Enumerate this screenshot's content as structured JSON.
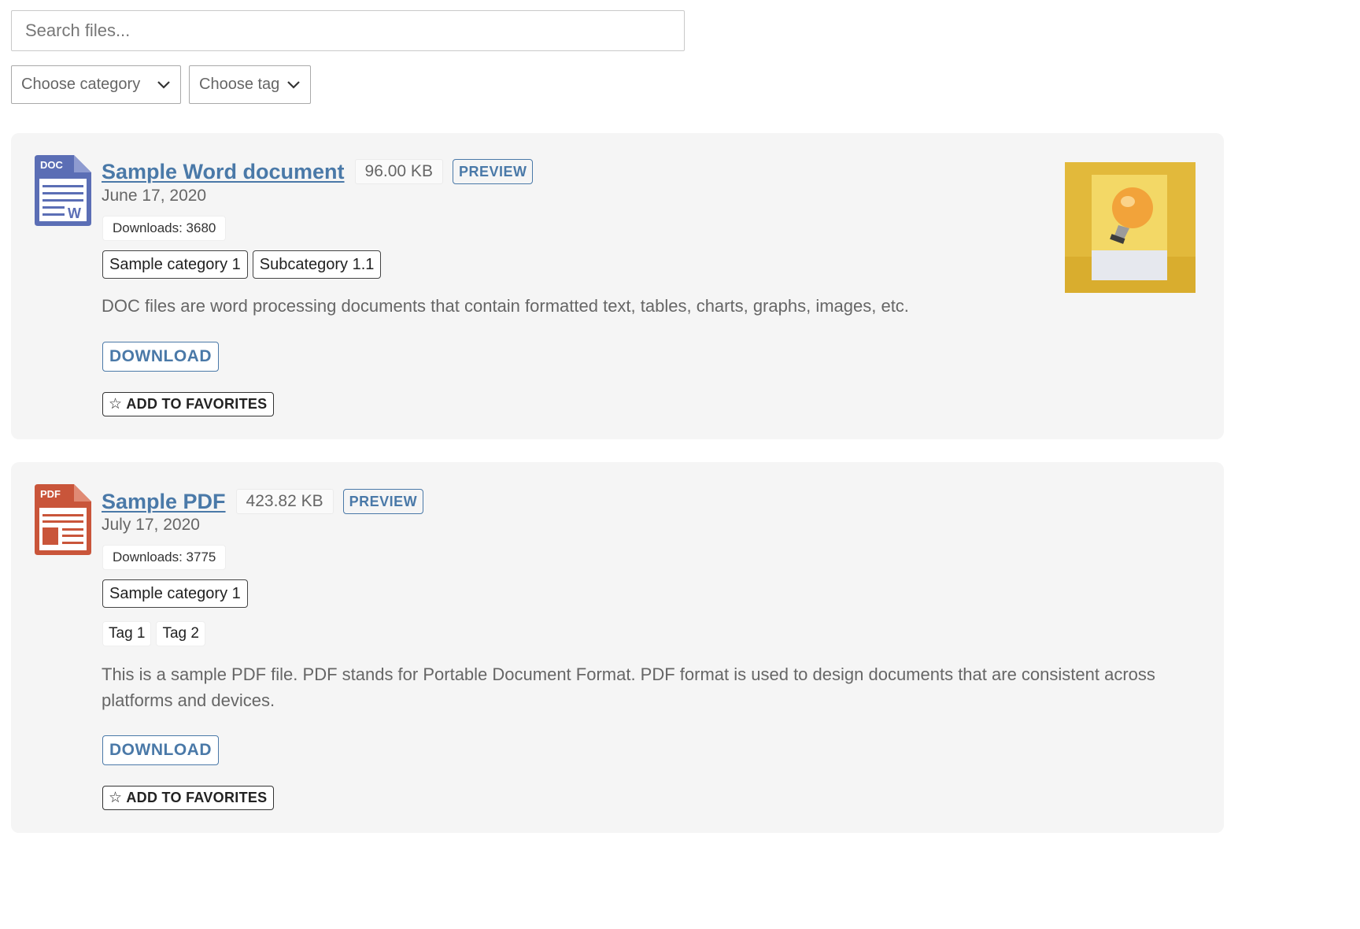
{
  "search": {
    "placeholder": "Search files..."
  },
  "filters": {
    "category": {
      "label": "Choose category"
    },
    "tag": {
      "label": "Choose tag"
    }
  },
  "files": [
    {
      "icon_label": "DOC",
      "icon_letter": "W",
      "icon_color": "#5b6eb5",
      "title": "Sample Word document",
      "size": "96.00 KB",
      "preview_label": "PREVIEW",
      "date": "June 17, 2020",
      "downloads": "Downloads: 3680",
      "categories": [
        "Sample category 1",
        "Subcategory 1.1"
      ],
      "tags": [],
      "description": "DOC files are word processing documents that contain formatted text, tables, charts, graphs, images, etc.",
      "download_label": "DOWNLOAD",
      "favorite_label": "ADD TO FAVORITES",
      "favorite_icon": "star-outline-icon",
      "thumbnail": "lightbulb-on-yellow-paper"
    },
    {
      "icon_label": "PDF",
      "icon_color": "#c9553a",
      "title": "Sample PDF",
      "size": "423.82 KB",
      "preview_label": "PREVIEW",
      "date": "July 17, 2020",
      "downloads": "Downloads: 3775",
      "categories": [
        "Sample category 1"
      ],
      "tags": [
        "Tag 1",
        "Tag 2"
      ],
      "description": "This is a sample PDF file. PDF stands for Portable Document Format. PDF format is used to design documents that are consistent across platforms and devices.",
      "download_label": "DOWNLOAD",
      "favorite_label": "ADD TO FAVORITES",
      "favorite_icon": "star-outline-icon"
    }
  ],
  "colors": {
    "link_blue": "#4a79a8",
    "card_bg": "#f5f5f5",
    "doc_icon": "#5b6eb5",
    "pdf_icon": "#c9553a"
  }
}
